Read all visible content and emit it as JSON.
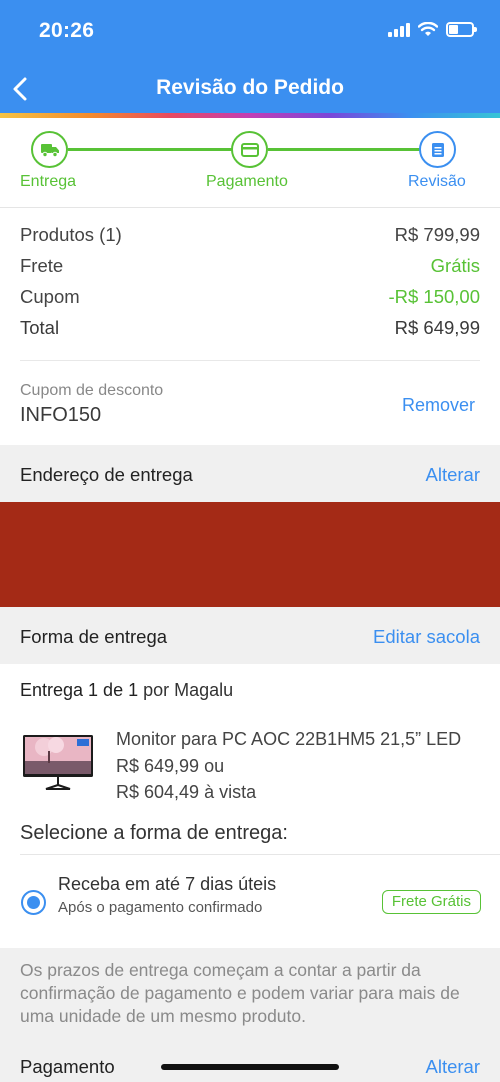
{
  "status_bar": {
    "time": "20:26"
  },
  "header": {
    "title": "Revisão do Pedido"
  },
  "steps": [
    {
      "label": "Entrega",
      "icon": "truck-icon"
    },
    {
      "label": "Pagamento",
      "icon": "credit-card-icon"
    },
    {
      "label": "Revisão",
      "icon": "document-icon"
    }
  ],
  "summary": {
    "products_label": "Produtos (1)",
    "products_value": "R$ 799,99",
    "shipping_label": "Frete",
    "shipping_value": "Grátis",
    "coupon_label": "Cupom",
    "coupon_value": "-R$ 150,00",
    "total_label": "Total",
    "total_value": "R$ 649,99"
  },
  "coupon": {
    "label": "Cupom de desconto",
    "code": "INFO150",
    "remove_label": "Remover"
  },
  "address": {
    "title": "Endereço de entrega",
    "action": "Alterar"
  },
  "delivery_method": {
    "title": "Forma de entrega",
    "action": "Editar sacola"
  },
  "delivery": {
    "heading_main": "Entrega 1 de 1",
    "heading_seller": " por Magalu",
    "product_name": "Monitor para PC AOC 22B1HM5 21,5” LED",
    "price_line": "R$ 649,99 ou",
    "cash_line": "R$ 604,49 à vista"
  },
  "select_title": "Selecione a forma de entrega:",
  "option": {
    "main": "Receba em até 7 dias úteis",
    "sub": "Após o pagamento confirmado",
    "badge": "Frete Grátis"
  },
  "notice": "Os prazos de entrega começam a contar a partir da confirmação de pagamento e podem variar para mais de uma unidade de um mesmo produto.",
  "payment": {
    "title": "Pagamento",
    "action": "Alterar"
  },
  "colors": {
    "primary": "#3b8ff0",
    "green": "#58c236",
    "redacted": "#a42a16"
  }
}
